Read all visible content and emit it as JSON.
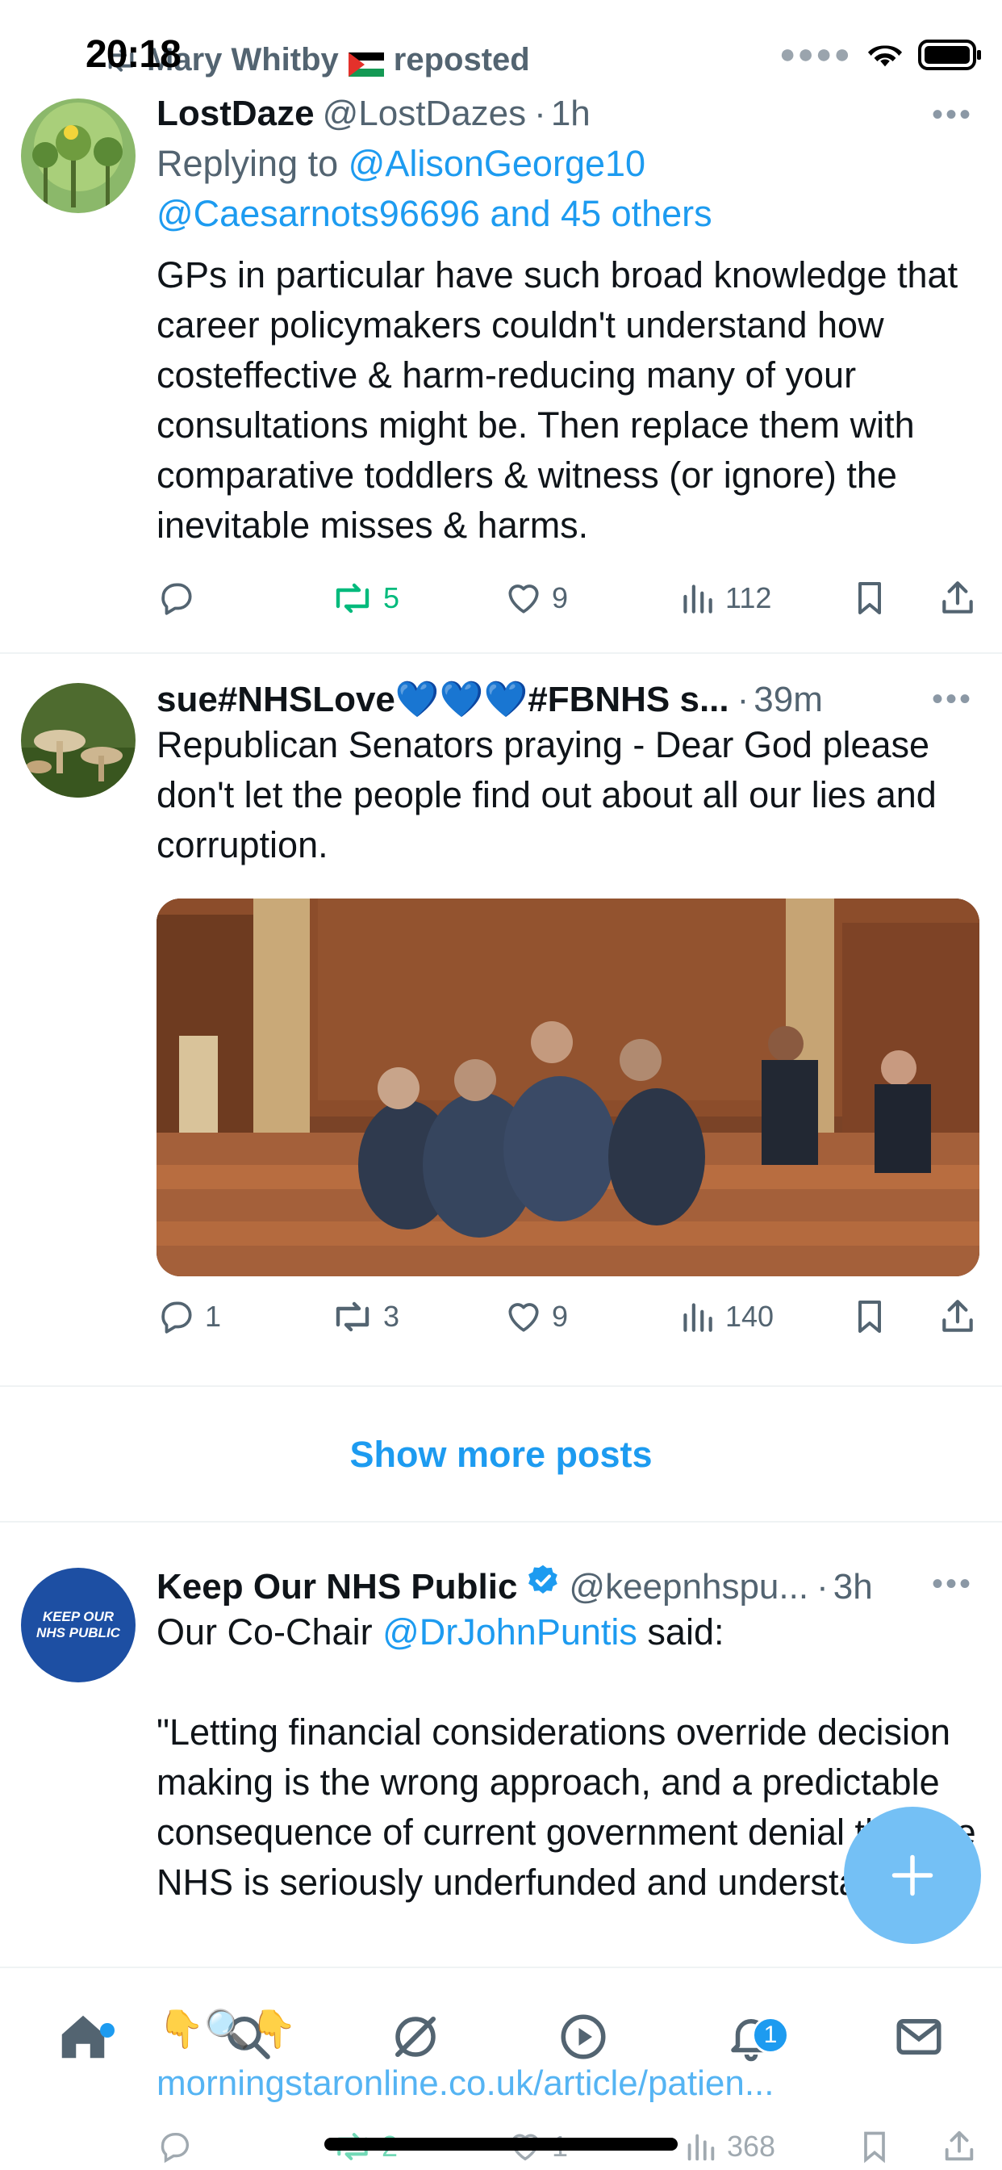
{
  "status_bar": {
    "time": "20:18"
  },
  "repost_banner": {
    "user": "Mary Whitby",
    "action": "reposted"
  },
  "tweet1": {
    "name": "LostDaze",
    "handle": "@LostDazes",
    "time": "1h",
    "replying_prefix": "Replying to",
    "reply_handle1": "@AlisonGeorge10",
    "reply_handle2": "@Caesarnots96696",
    "reply_others": "and 45 others",
    "text": "GPs in particular have such broad knowledge that career policymakers couldn't understand how costeffective & harm-reducing many of your consultations might be. Then replace them with comparative toddlers & witness (or ignore) the inevitable misses & harms.",
    "reposts": "5",
    "likes": "9",
    "views": "112"
  },
  "tweet2": {
    "name": "sue#NHSLove💙💙💙#FBNHS s...",
    "time": "39m",
    "text": "Republican Senators praying - Dear God please don't let the people find out about all our lies and corruption.",
    "replies": "1",
    "reposts": "3",
    "likes": "9",
    "views": "140"
  },
  "show_more": "Show more posts",
  "tweet3": {
    "name": "Keep Our NHS Public",
    "handle": "@keepnhspu...",
    "time": "3h",
    "avatar_text_line1": "KEEP OUR",
    "avatar_text_line2": "NHS PUBLIC",
    "text_prefix": "Our Co-Chair",
    "mention": "@DrJohnPuntis",
    "text_suffix": "said:",
    "quote": "\"Letting financial considerations override decision making is the wrong approach, and a predictable consequence of current government denial that the NHS is seriously underfunded and understaffed.\"",
    "emoji_line": "👇🔍👇",
    "link": "morningstaronline.co.uk/article/patien...",
    "reposts": "2",
    "likes": "1",
    "views": "368"
  },
  "tabbar": {
    "notifications_badge": "1"
  },
  "colors": {
    "accent": "#1d9bf0",
    "muted": "#536471",
    "repost_green": "#00ba7c"
  }
}
